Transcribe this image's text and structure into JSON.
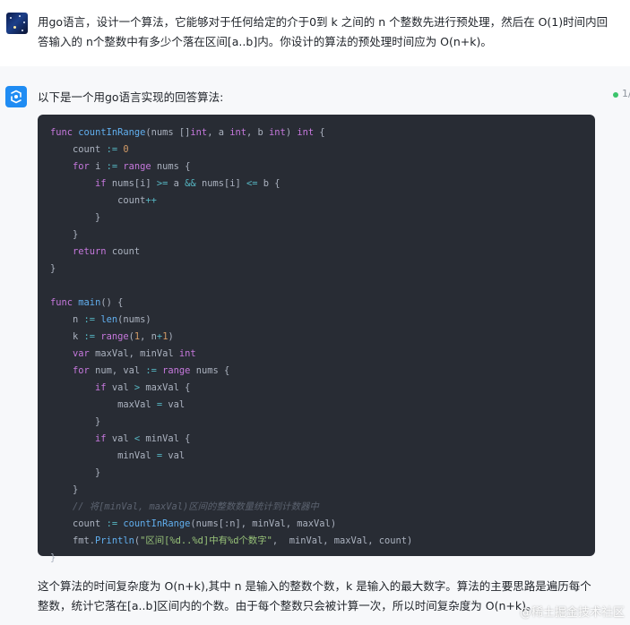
{
  "user_message": {
    "avatar": "starry-night-avatar",
    "text": "用go语言，设计一个算法，它能够对于任何给定的介于0到 k 之间的 n 个整数先进行预处理，然后在 O(1)时间内回答输入的 n个整数中有多少个落在区间[a..b]内。你设计的算法的预处理时间应为 O(n+k)。"
  },
  "bot_message": {
    "avatar": "bot-logo-icon",
    "intro": "以下是一个用go语言实现的回答算法:",
    "status_text": "1/",
    "code_lines": [
      "func countInRange(nums []int, a int, b int) int {",
      "    count := 0",
      "    for i := range nums {",
      "        if nums[i] >= a && nums[i] <= b {",
      "            count++",
      "        }",
      "    }",
      "    return count",
      "}",
      "",
      "func main() {",
      "    n := len(nums)",
      "    k := range(1, n+1)",
      "    var maxVal, minVal int",
      "    for num, val := range nums {",
      "        if val > maxVal {",
      "            maxVal = val",
      "        }",
      "        if val < minVal {",
      "            minVal = val",
      "        }",
      "    }",
      "    // 将[minVal, maxVal)区间的整数数量统计到计数器中",
      "    count := countInRange(nums[:n], minVal, maxVal)",
      "    fmt.Println(\"区间[%d..%d]中有%d个数字\",  minVal, maxVal, count)",
      "}"
    ],
    "summary": "这个算法的时间复杂度为 O(n+k),其中 n 是输入的整数个数，k 是输入的最大数字。算法的主要思路是遍历每个整数，统计它落在[a..b]区间内的个数。由于每个整数只会被计算一次，所以时间复杂度为 O(n+k)。"
  },
  "watermark": "@稀土掘金技术社区",
  "colors": {
    "code_bg": "#282c34",
    "keyword": "#c678dd",
    "function": "#61afef",
    "number": "#d19a66",
    "string": "#98c379",
    "comment": "#5c6370",
    "accent": "#1f8cf3",
    "status": "#3bc46b"
  }
}
